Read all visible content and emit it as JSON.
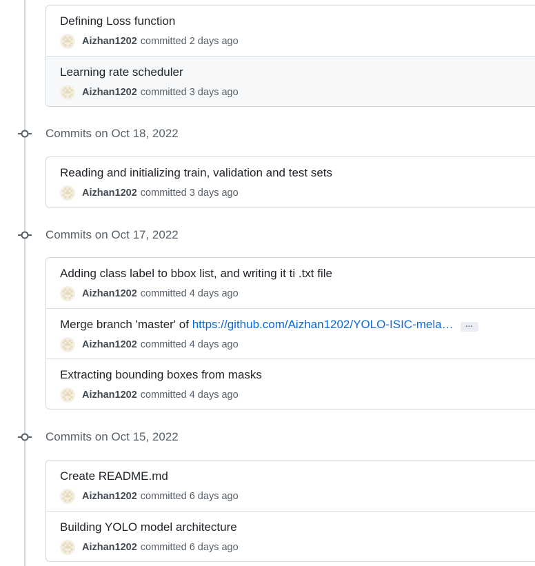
{
  "groups": [
    {
      "header": "",
      "commits": [
        {
          "title": "Defining Loss function",
          "author": "Aizhan1202",
          "verb": "committed",
          "time": "2 days ago"
        },
        {
          "title": "Learning rate scheduler",
          "author": "Aizhan1202",
          "verb": "committed",
          "time": "3 days ago"
        }
      ]
    },
    {
      "header": "Commits on Oct 18, 2022",
      "commits": [
        {
          "title": "Reading and initializing train, validation and test sets",
          "author": "Aizhan1202",
          "verb": "committed",
          "time": "3 days ago"
        }
      ]
    },
    {
      "header": "Commits on Oct 17, 2022",
      "commits": [
        {
          "title": "Adding class label to bbox list, and writing it ti .txt file",
          "author": "Aizhan1202",
          "verb": "committed",
          "time": "4 days ago"
        },
        {
          "title": "Merge branch 'master' of ",
          "link": "https://github.com/Aizhan1202/YOLO-ISIC-mela…",
          "ellipsis": "…",
          "author": "Aizhan1202",
          "verb": "committed",
          "time": "4 days ago"
        },
        {
          "title": "Extracting bounding boxes from masks",
          "author": "Aizhan1202",
          "verb": "committed",
          "time": "4 days ago"
        }
      ]
    },
    {
      "header": "Commits on Oct 15, 2022",
      "commits": [
        {
          "title": "Create README.md",
          "author": "Aizhan1202",
          "verb": "committed",
          "time": "6 days ago"
        },
        {
          "title": "Building YOLO model architecture",
          "author": "Aizhan1202",
          "verb": "committed",
          "time": "6 days ago"
        }
      ]
    }
  ],
  "icons": {
    "timeline": "git-commit-icon",
    "avatar": "identicon-avatar"
  },
  "colors": {
    "link": "#0969da",
    "border": "#d0d7de",
    "muted": "#57606a",
    "avatar_fill": "#e8d8b8",
    "avatar_bg": "#f4efe4"
  }
}
